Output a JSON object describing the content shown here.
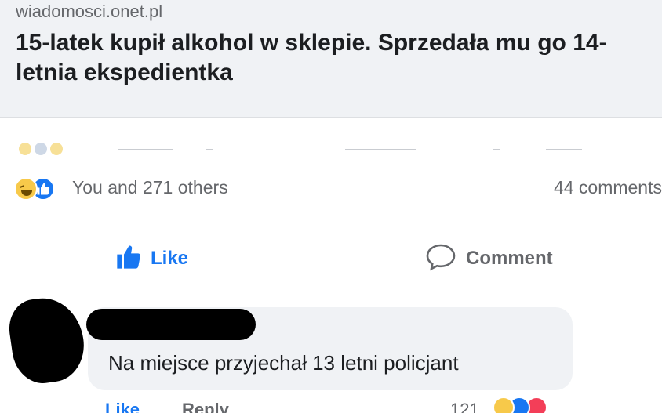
{
  "link_preview": {
    "domain": "wiadomosci.onet.pl",
    "title": "15-latek kupił alkohol w sklepie. Sprzedała mu go 14-letnia ekspedientka"
  },
  "reactions": {
    "summary": "You and 271 others",
    "comments": "44 comments",
    "icons": [
      "haha-icon",
      "like-icon"
    ]
  },
  "actions": {
    "like_label": "Like",
    "comment_label": "Comment"
  },
  "comment": {
    "text": "Na miejsce przyjechał 13 letni policjant",
    "like_label": "Like",
    "reply_label": "Reply",
    "reaction_count": "121",
    "reaction_icons": [
      "haha-icon",
      "like-icon",
      "love-icon"
    ]
  },
  "colors": {
    "accent": "#1877f2",
    "muted_text": "#65676b",
    "preview_bg": "#f0f2f5"
  }
}
